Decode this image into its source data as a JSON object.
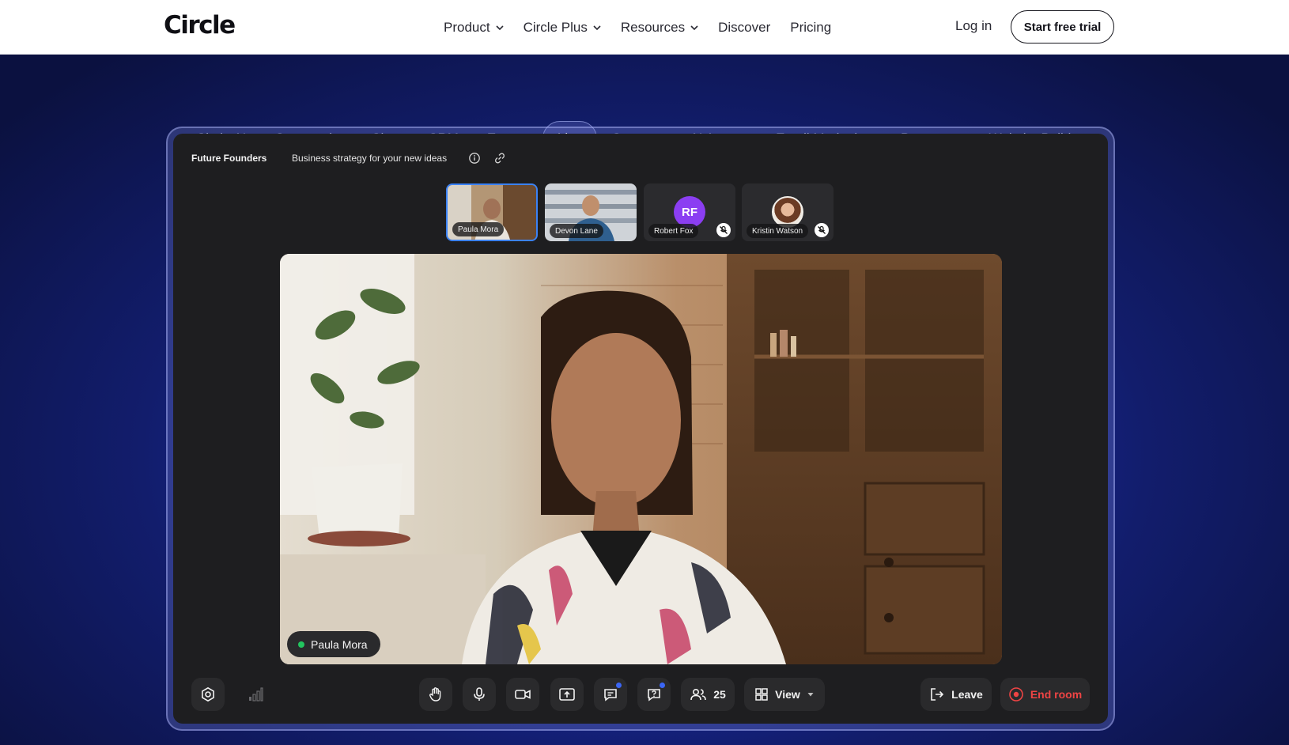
{
  "nav": {
    "logo": "Circle",
    "links": [
      {
        "label": "Product",
        "has_dropdown": true
      },
      {
        "label": "Circle Plus",
        "has_dropdown": true
      },
      {
        "label": "Resources",
        "has_dropdown": true
      },
      {
        "label": "Discover",
        "has_dropdown": false
      },
      {
        "label": "Pricing",
        "has_dropdown": false
      }
    ],
    "login": "Log in",
    "cta": "Start free trial"
  },
  "feature_tabs": [
    {
      "label": "Circle AI",
      "active": false
    },
    {
      "label": "Community",
      "active": false
    },
    {
      "label": "Chat",
      "active": false
    },
    {
      "label": "CRM",
      "active": false
    },
    {
      "label": "Events",
      "active": false
    },
    {
      "label": "Live",
      "active": true
    },
    {
      "label": "Courses",
      "active": false
    },
    {
      "label": "AI Agents",
      "active": false
    },
    {
      "label": "Email Marketing",
      "active": false
    },
    {
      "label": "Payments",
      "active": false
    },
    {
      "label": "Website Builder",
      "active": false
    }
  ],
  "room": {
    "title": "Future Founders",
    "subtitle": "Business strategy for your new ideas",
    "icons": [
      "info-icon",
      "link-icon"
    ],
    "participants": [
      {
        "name": "Paula Mora",
        "initials": "",
        "muted": false,
        "active": true
      },
      {
        "name": "Devon Lane",
        "initials": "",
        "muted": false,
        "active": false
      },
      {
        "name": "Robert Fox",
        "initials": "RF",
        "muted": true,
        "active": false
      },
      {
        "name": "Kristin Watson",
        "initials": "",
        "muted": true,
        "active": false
      }
    ],
    "speaker": "Paula Mora",
    "controls": {
      "participant_count": "25",
      "view_label": "View",
      "leave_label": "Leave",
      "end_label": "End room"
    }
  },
  "colors": {
    "accent_blue": "#3b82f6",
    "end_red": "#ef4444",
    "live_green": "#22c55e",
    "avatar_purple": "#8b3ef2"
  }
}
